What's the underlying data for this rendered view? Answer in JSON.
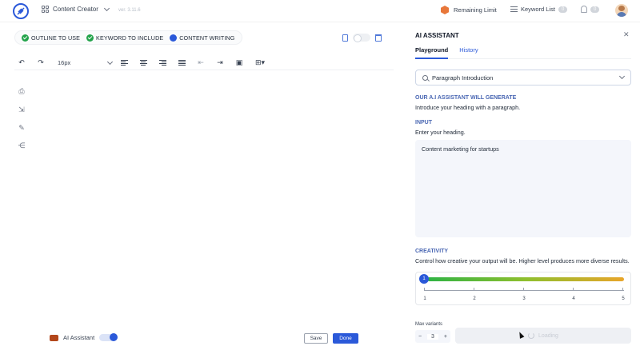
{
  "header": {
    "app_name": "Content Creator",
    "version": "ver. 3.11.6",
    "remaining_limit": "Remaining Limit",
    "keyword_list": "Keyword List",
    "keyword_count": "0",
    "notification_count": "0"
  },
  "steps": [
    {
      "label": "OUTLINE TO USE",
      "status": "done"
    },
    {
      "label": "KEYWORD TO INCLUDE",
      "status": "done"
    },
    {
      "label": "CONTENT WRITING",
      "status": "active"
    }
  ],
  "toolbar": {
    "font_size": "16px"
  },
  "footer": {
    "ai_assistant_label": "AI Assistant",
    "save_label": "Save",
    "done_label": "Done"
  },
  "panel": {
    "title": "AI ASSISTANT",
    "tabs": [
      "Playground",
      "History"
    ],
    "selected_template": "Paragraph Introduction",
    "generate_heading": "OUR A.I ASSISTANT WILL GENERATE",
    "generate_text": "Introduce your heading with a paragraph.",
    "input_heading": "INPUT",
    "input_prompt": "Enter your heading.",
    "input_value": "Content marketing for startups",
    "creativity_heading": "CREATIVITY",
    "creativity_text": "Control how creative your output will be. Higher level produces more diverse results.",
    "creativity_level": "1",
    "scale_labels": [
      "1",
      "2",
      "3",
      "4",
      "5"
    ],
    "max_variants_label": "Max variants",
    "max_variants": "3",
    "loading_label": "Loading"
  },
  "colors": {
    "accent": "#2b59d9",
    "success": "#22a34a",
    "section_heading": "#4a67b3"
  }
}
